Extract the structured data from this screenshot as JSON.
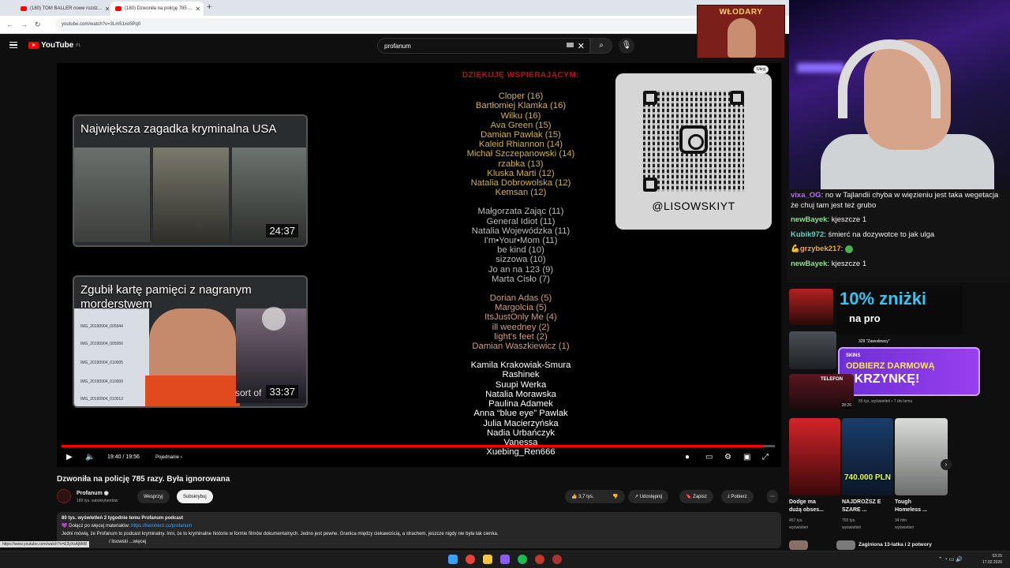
{
  "browser": {
    "tabs": [
      {
        "label": "(180) TOM BALLER nowe rozdz..."
      },
      {
        "label": "(180) Dzwoniła na policję 785 ..."
      }
    ],
    "url": "youtube.com/watch?v=3Lm51xo5Pq0"
  },
  "youtube": {
    "logo": "YouTube",
    "logo_region": "PL",
    "search_value": "profanum",
    "hide_label": "Ukryj"
  },
  "player": {
    "thumb1": {
      "title": "Największa zagadka kryminalna USA",
      "duration": "24:37"
    },
    "thumb2": {
      "title": "Zgubił kartę pamięci z nagranym morderstwem",
      "duration": "33:37",
      "overlay_text": "sort of"
    },
    "files": [
      "IMG_20190904_005944",
      "IMG_20190904_005956",
      "IMG_20190904_010005",
      "IMG_20190904_010009",
      "IMG_20190904_010013"
    ],
    "credits_heading": "DZIĘKUJĘ WSPIERAJĄCYM:",
    "credits_gold": [
      "Cloper (16)",
      "Bartłomiej Klamka (16)",
      "Wilku (16)",
      "Ava Green (15)",
      "Damian Pawlak (15)",
      "Kaleid Rhiannon (14)",
      "Michał Szczepanowski (14)",
      "rzabka (13)",
      "Kluska Marti (12)",
      "Natalia Dobrowolska (12)",
      "Kemsan (12)"
    ],
    "credits_silver": [
      "Małgorzata Zając (11)",
      "General Idiot (11)",
      "Natalia Wojewódzka (11)",
      "I'm•Your•Mom (11)",
      "be kind (10)",
      "sizzowa (10)",
      "Jo an na 123 (9)",
      "Marta Cisło (7)"
    ],
    "credits_bronze": [
      "Dorian Adas (5)",
      "Margolcia (5)",
      "ItsJustOnly Me (4)",
      "ill weedney (2)",
      "light's feet (2)",
      "Damian Waszkiewicz (1)"
    ],
    "credits_white": [
      "Kamila Krakowiak-Smura",
      "Rashinek",
      "Suupi Werka",
      "Natalia Morawska",
      "Paulina Adamek",
      "Anna “blue eye” Pawlak",
      "Julia Macierzyńska",
      "Nadia Urbańczyk",
      "Vanessa",
      "Xuebing_Ren666"
    ],
    "qr_handle": "@LISOWSKIYT",
    "progress": 0.985,
    "time": "19:40 / 19:56",
    "chapter": "Pojednanie"
  },
  "video": {
    "title": "Dzwoniła na policję 785 razy. Była ignorowana",
    "channel": "Profanum",
    "subs": "169 tys. subskrybentów",
    "support_label": "Wesprzyj",
    "subscribe_label": "Subskrybuj",
    "likes": "3,7 tys.",
    "share_label": "Udostępnij",
    "save_label": "Zapisz",
    "download_label": "Pobierz",
    "desc_meta": "80 tys. wyświetleń  2 tygodnie temu  Profanum podcast",
    "desc_line2_prefix": "💜 Dołącz po więcej materiałów: ",
    "desc_link": "https://herohero.co/profanum",
    "desc_line3": "Jedni mówią, że Profanum to podcast kryminalny. Inni, że to kryminalne historie w formie filmów dokumentalnych. Jedno jest pewne. Granica między ciekawością, a strachem, jeszcze nigdy nie była tak cienka.",
    "desc_line4": "/ lisowski   ...więcej",
    "status_url": "https://www.youtube.com/watch?v=E3yXsAjMtI8"
  },
  "stream": {
    "banner": "WŁODARY",
    "chat": [
      {
        "user": "vixa_OG",
        "text": "no w Tajlandii chyba w więzieniu jest taka wegetacja że chuj tam jest też grubo"
      },
      {
        "user": "newBayek",
        "text": "kjeszcze 1"
      },
      {
        "user": "Kubik972",
        "text": "śmierć na dozywotce to jak ulga"
      },
      {
        "user": "grzybek217",
        "text": ""
      },
      {
        "user": "newBayek",
        "text": "kjeszcze 1"
      }
    ],
    "promo_big": "10% zniżki",
    "promo_small": "na pro",
    "skins_brand": "SKINS",
    "skins_l1": "ODBIERZ DARMOWĄ",
    "skins_l2": "SKRZYNKĘ!",
    "zawodowcy": "329 \"Zawodowcy\"",
    "side_views": "55 tys. wyświetleń • 7 dni temu",
    "telefon_label": "TELEFON",
    "thumb_duration": "28:26",
    "pln_label": "740.000 PLN",
    "sidebar_items": [
      {
        "title": "Dodge ma dużą obses...",
        "views": "457 tys.",
        "views2": "wyświetleń"
      },
      {
        "title": "NAJDROŻSZ E SZARE ...",
        "views": "765 tys.",
        "views2": "wyświetleń"
      },
      {
        "title": "Tough Homeless ...",
        "views": "34 mln",
        "views2": "wyświetleń"
      }
    ],
    "bottom_title": "Zaginiona 13-latka i 2 potwory"
  },
  "taskbar": {
    "time": "03:25",
    "date": "17.02.2026"
  }
}
